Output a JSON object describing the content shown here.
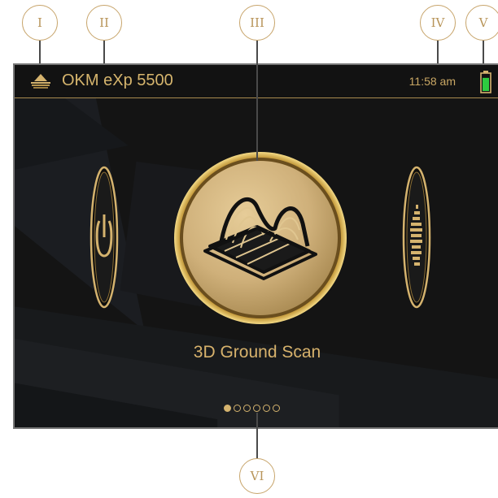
{
  "callouts": [
    "I",
    "II",
    "III",
    "IV",
    "V",
    "VI"
  ],
  "status_bar": {
    "device_name": "OKM eXp 5500",
    "time": "11:58 am",
    "battery_level": 0.85,
    "battery_color": "#2ecc40"
  },
  "carousel": {
    "current_mode_label": "3D Ground Scan",
    "page_count": 6,
    "active_page": 1,
    "center_icon": "3d-terrain-icon",
    "left_icon": "power-icon",
    "right_icon": "equalizer-icon"
  },
  "colors": {
    "accent_gold": "#d5b36e",
    "background": "#141414",
    "callout_ring": "#c7a46a"
  }
}
